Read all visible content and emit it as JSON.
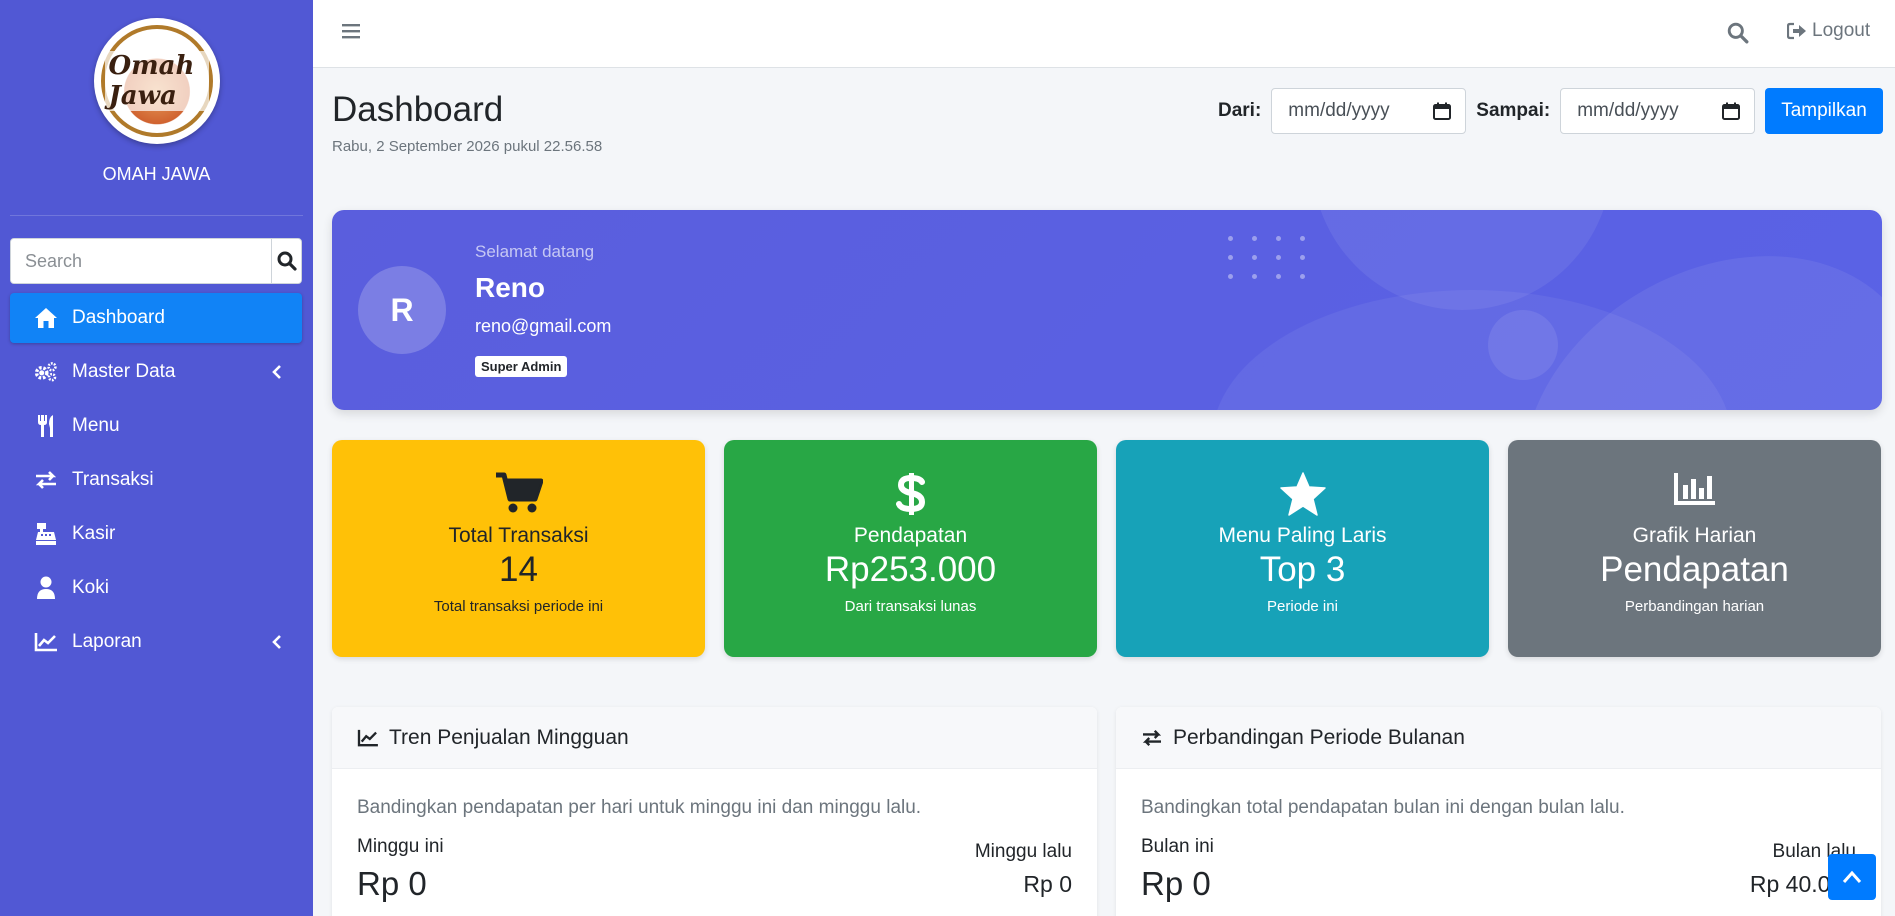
{
  "brand": {
    "name": "OMAH JAWA",
    "logo_text": "Omah Jawa"
  },
  "sidebar": {
    "search_placeholder": "Search",
    "items": [
      {
        "label": "Dashboard",
        "icon": "home-icon",
        "active": true
      },
      {
        "label": "Master Data",
        "icon": "cogs-icon",
        "has_submenu": true
      },
      {
        "label": "Menu",
        "icon": "utensils-icon"
      },
      {
        "label": "Transaksi",
        "icon": "exchange-icon"
      },
      {
        "label": "Kasir",
        "icon": "cash-register-icon"
      },
      {
        "label": "Koki",
        "icon": "user-icon"
      },
      {
        "label": "Laporan",
        "icon": "chart-line-icon",
        "has_submenu": true
      }
    ]
  },
  "topbar": {
    "logout_label": "Logout"
  },
  "header": {
    "title": "Dashboard",
    "datetime": "Rabu, 2 September 2026 pukul 22.56.58",
    "from_label": "Dari:",
    "to_label": "Sampai:",
    "from_placeholder": "mm/dd/yyyy",
    "to_placeholder": "mm/dd/yyyy",
    "show_button": "Tampilkan"
  },
  "welcome": {
    "greeting": "Selamat datang",
    "initial": "R",
    "name": "Reno",
    "email": "reno@gmail.com",
    "role": "Super Admin"
  },
  "cards": [
    {
      "title": "Total Transaksi",
      "value": "14",
      "subtitle": "Total transaksi periode ini",
      "icon": "cart-icon",
      "color": "#ffc107"
    },
    {
      "title": "Pendapatan",
      "value": "Rp253.000",
      "subtitle": "Dari transaksi lunas",
      "icon": "dollar-icon",
      "color": "#28a745"
    },
    {
      "title": "Menu Paling Laris",
      "value": "Top 3",
      "subtitle": "Periode ini",
      "icon": "star-icon",
      "color": "#17a2b8"
    },
    {
      "title": "Grafik Harian",
      "value": "Pendapatan",
      "subtitle": "Perbandingan harian",
      "icon": "bar-chart-icon",
      "color": "#6c757d"
    }
  ],
  "panels": {
    "weekly": {
      "title": "Tren Penjualan Mingguan",
      "description": "Bandingkan pendapatan per hari untuk minggu ini dan minggu lalu.",
      "current_label": "Minggu ini",
      "current_value": "Rp 0",
      "previous_label": "Minggu lalu",
      "previous_value": "Rp 0"
    },
    "monthly": {
      "title": "Perbandingan Periode Bulanan",
      "description": "Bandingkan total pendapatan bulan ini dengan bulan lalu.",
      "current_label": "Bulan ini",
      "current_value": "Rp 0",
      "previous_label": "Bulan lalu",
      "previous_value": "Rp 40.000"
    }
  },
  "colors": {
    "sidebar": "#5158d4",
    "active": "#1183f6",
    "primary": "#007bff"
  }
}
